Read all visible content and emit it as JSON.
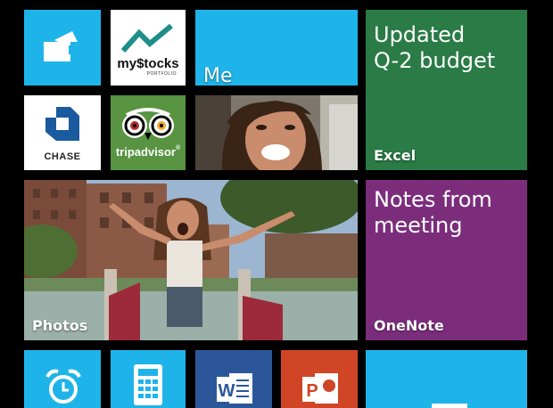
{
  "colors": {
    "cyan": "#1FB4E9",
    "green": "#2A7B46",
    "purple": "#7B2D7C",
    "word_blue": "#2B579A",
    "powerpoint_red": "#D04525",
    "tripadvisor_green": "#589442",
    "chase_blue": "#1A5A9E"
  },
  "tiles": {
    "wallet": {
      "icon": "wallet-icon"
    },
    "mystocks": {
      "logo_main": "my$tocks",
      "logo_sub": "PORTFOLIO"
    },
    "me": {
      "label": "Me"
    },
    "excel": {
      "title_line1": "Updated",
      "title_line2": "Q-2 budget",
      "label": "Excel"
    },
    "chase": {
      "label": "CHASE"
    },
    "tripadvisor": {
      "label": "tripadvisor",
      "mark": "®"
    },
    "photos": {
      "label": "Photos"
    },
    "onenote": {
      "title_line1": "Notes from",
      "title_line2": "meeting",
      "label": "OneNote"
    },
    "alarms": {
      "icon": "alarm-clock-icon"
    },
    "calculator": {
      "icon": "calculator-icon"
    },
    "word": {
      "icon": "word-icon",
      "letter": "W"
    },
    "powerpoint": {
      "icon": "powerpoint-icon",
      "letter": "P"
    },
    "cyan_wide": {
      "icon": "minus-icon"
    }
  }
}
